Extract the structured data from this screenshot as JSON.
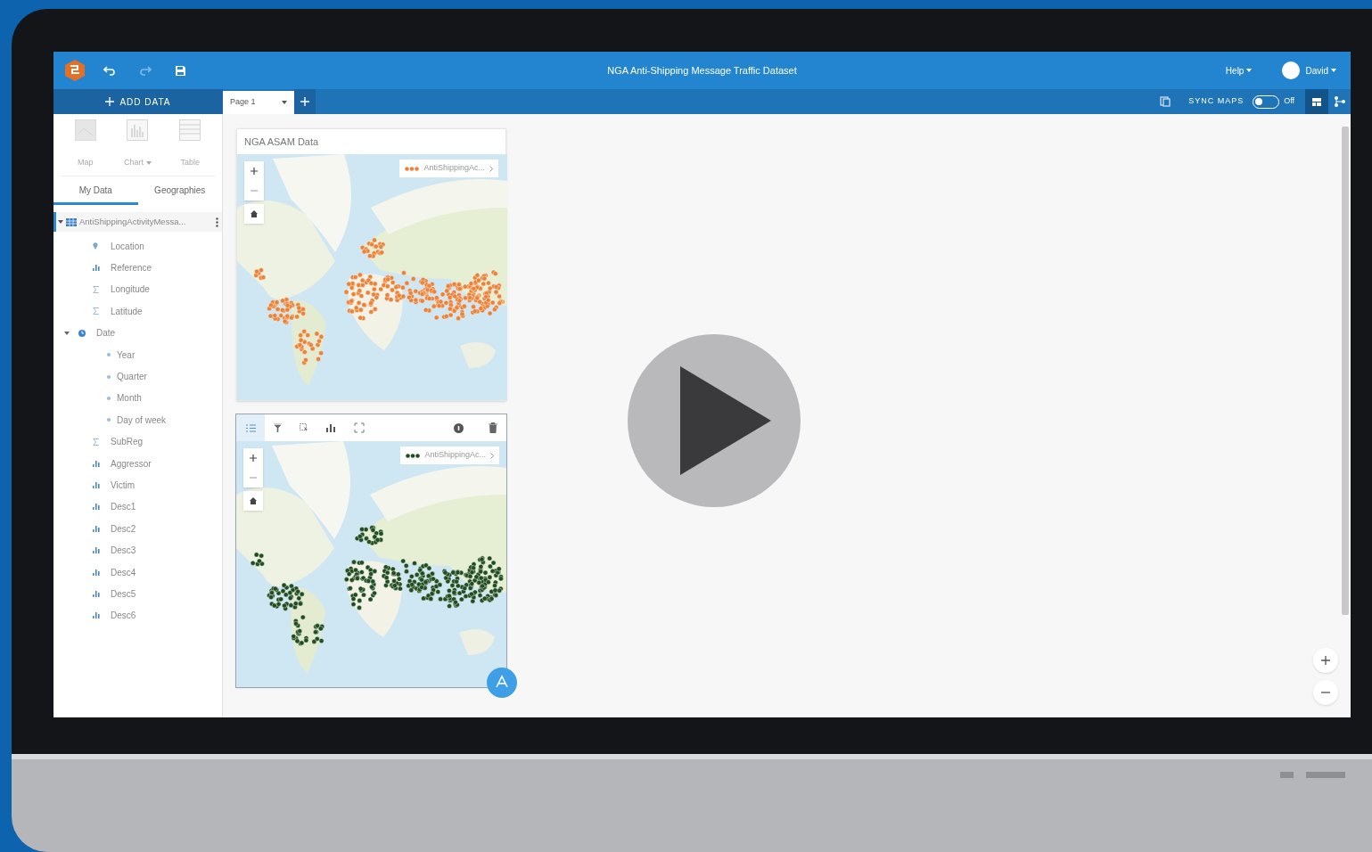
{
  "app": {
    "title": "NGA Anti-Shipping Message Traffic Dataset",
    "help": "Help",
    "user": "David"
  },
  "toolbar": {
    "add_data": "ADD DATA",
    "pages": [
      {
        "label": "Page 1",
        "selected": true
      }
    ],
    "sync_maps": {
      "label": "SYNC MAPS",
      "on": false,
      "state_label": "Off"
    }
  },
  "sidebar": {
    "viz_buttons": [
      {
        "label": "Map",
        "kind": "map",
        "dropdown": false
      },
      {
        "label": "Chart",
        "kind": "chart",
        "dropdown": true
      },
      {
        "label": "Table",
        "kind": "table",
        "dropdown": false
      }
    ],
    "tabs": [
      {
        "label": "My Data",
        "selected": true
      },
      {
        "label": "Geographies",
        "selected": false
      }
    ],
    "dataset": {
      "name": "AntiShippingActivityMessa...",
      "expanded": true,
      "fields": [
        {
          "name": "Location",
          "kind": "location"
        },
        {
          "name": "Reference",
          "kind": "string"
        },
        {
          "name": "Longitude",
          "kind": "number"
        },
        {
          "name": "Latitude",
          "kind": "number"
        },
        {
          "name": "Date",
          "kind": "date",
          "expanded": true,
          "children": [
            {
              "name": "Year",
              "kind": "date-part"
            },
            {
              "name": "Quarter",
              "kind": "date-part"
            },
            {
              "name": "Month",
              "kind": "date-part"
            },
            {
              "name": "Day of week",
              "kind": "date-part"
            }
          ]
        },
        {
          "name": "SubReg",
          "kind": "number"
        },
        {
          "name": "Aggressor",
          "kind": "string"
        },
        {
          "name": "Victim",
          "kind": "string"
        },
        {
          "name": "Desc1",
          "kind": "string"
        },
        {
          "name": "Desc2",
          "kind": "string"
        },
        {
          "name": "Desc3",
          "kind": "string"
        },
        {
          "name": "Desc4",
          "kind": "string"
        },
        {
          "name": "Desc5",
          "kind": "string"
        },
        {
          "name": "Desc6",
          "kind": "string"
        }
      ]
    }
  },
  "cards": [
    {
      "title": "NGA ASAM Data",
      "legend": "AntiShippingAc...",
      "color": "#e8833a",
      "selected": false
    },
    {
      "legend": "AntiShippingAc...",
      "color": "#1f4d1f",
      "selected": true
    }
  ]
}
